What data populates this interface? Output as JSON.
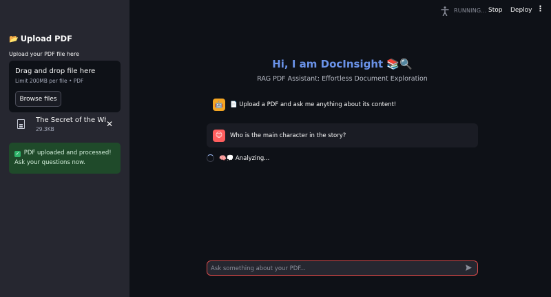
{
  "sidebar": {
    "header": "Upload PDF",
    "header_icon": "📂",
    "uploader_label": "Upload your PDF file here",
    "dropzone": {
      "title": "Drag and drop file here",
      "limit": "Limit 200MB per file • PDF",
      "browse_label": "Browse files"
    },
    "file": {
      "name": "The Secret of the Whi…",
      "size": "29.3KB"
    },
    "success": {
      "icon": "✓",
      "text": "PDF uploaded and processed! Ask your questions now."
    }
  },
  "header": {
    "running_label": "RUNNING...",
    "stop_label": "Stop",
    "deploy_label": "Deploy",
    "menu_icon": "⋮"
  },
  "main": {
    "title": "Hi, I am DocInsight 📚🔍",
    "subtitle": "RAG PDF Assistant: Effortless Document Exploration",
    "messages": [
      {
        "role": "assistant",
        "avatar_icon": "🤖",
        "text": "📄 Upload a PDF and ask me anything about its content!"
      },
      {
        "role": "user",
        "avatar_icon": "😊",
        "text": "Who is the main character in the story?"
      }
    ],
    "status": "🧠💭 Analyzing..."
  },
  "chat_input": {
    "placeholder": "Ask something about your PDF..."
  },
  "colors": {
    "background": "#0e1117",
    "sidebar": "#262730",
    "title_accent": "#6a92e8",
    "success_bg": "#1f4a2a",
    "input_border": "#d94a4a"
  }
}
